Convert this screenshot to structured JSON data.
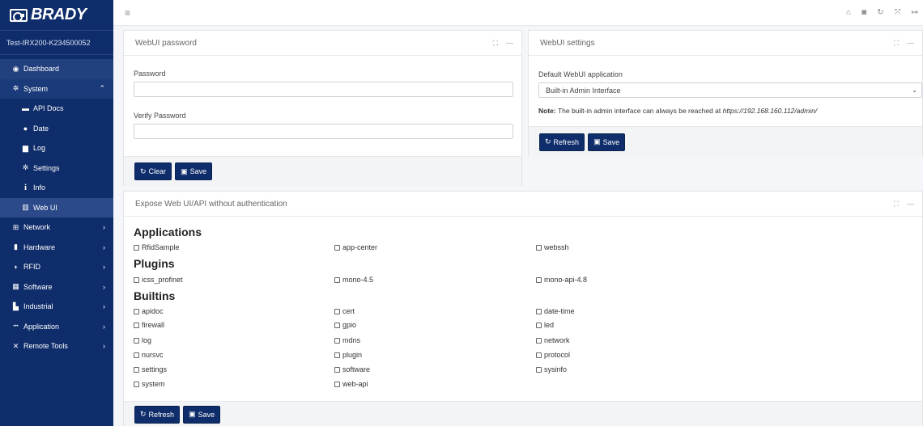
{
  "brand": {
    "name": "BRADY"
  },
  "device": {
    "name": "Test-IRX200-K234500052"
  },
  "sidebar": {
    "items": [
      {
        "label": "Dashboard",
        "icon": "dashboard-icon",
        "glyph": "◉"
      },
      {
        "label": "System",
        "icon": "gear-icon",
        "glyph": "✲",
        "chevron": "⌃"
      },
      {
        "label": "API Docs",
        "icon": "book-icon",
        "glyph": "▬"
      },
      {
        "label": "Date",
        "icon": "clock-icon",
        "glyph": "●"
      },
      {
        "label": "Log",
        "icon": "file-icon",
        "glyph": "▆"
      },
      {
        "label": "Settings",
        "icon": "gear-icon",
        "glyph": "✲"
      },
      {
        "label": "Info",
        "icon": "info-icon",
        "glyph": "i"
      },
      {
        "label": "Web UI",
        "icon": "columns-icon",
        "glyph": "▥"
      },
      {
        "label": "Network",
        "icon": "network-icon",
        "glyph": "⊞",
        "chevron": "›"
      },
      {
        "label": "Hardware",
        "icon": "hardware-icon",
        "glyph": "▮",
        "chevron": "›"
      },
      {
        "label": "RFID",
        "icon": "rfid-icon",
        "glyph": "◗",
        "chevron": "›"
      },
      {
        "label": "Software",
        "icon": "grid-icon",
        "glyph": "▦",
        "chevron": "›"
      },
      {
        "label": "Industrial",
        "icon": "industry-icon",
        "glyph": "▙",
        "chevron": "›"
      },
      {
        "label": "Application",
        "icon": "dots-icon",
        "glyph": "•••",
        "chevron": "›"
      },
      {
        "label": "Remote Tools",
        "icon": "tools-icon",
        "glyph": "✕",
        "chevron": "›"
      }
    ]
  },
  "topbar": {
    "menu_glyph": "≡",
    "icons": [
      "⌂",
      "◙",
      "↻",
      "⤧",
      "↦"
    ]
  },
  "password_card": {
    "title": "WebUI password",
    "password_label": "Password",
    "verify_label": "Verify Password",
    "clear_label": "Clear",
    "save_label": "Save"
  },
  "settings_card": {
    "title": "WebUI settings",
    "default_label": "Default WebUI application",
    "selected_app": "Built-in Admin Interface",
    "note_bold": "Note:",
    "note_text": " The built-in admin interface can always be reached at ",
    "note_url": "https://192.168.160.112/admin/",
    "refresh_label": "Refresh",
    "save_label": "Save"
  },
  "expose_card": {
    "title": "Expose Web UI/API without authentication",
    "sections": [
      {
        "title": "Applications",
        "items": [
          "RfidSample",
          "app-center",
          "webssh"
        ]
      },
      {
        "title": "Plugins",
        "items": [
          "icss_profinet",
          "mono-4.5",
          "mono-api-4.8"
        ]
      },
      {
        "title": "Builtins",
        "items": [
          "apidoc",
          "cert",
          "date-time",
          "firewall",
          "gpio",
          "led",
          "log",
          "mdns",
          "network",
          "nursvc",
          "plugin",
          "protocol",
          "settings",
          "software",
          "sysinfo",
          "system",
          "web-api"
        ]
      }
    ],
    "refresh_label": "Refresh",
    "save_label": "Save"
  },
  "card_tools": {
    "expand": "⛶",
    "collapse": "—"
  },
  "colors": {
    "sidebar": "#0f2d6b",
    "button": "#0f2d6b",
    "background": "#f4f6f9"
  }
}
